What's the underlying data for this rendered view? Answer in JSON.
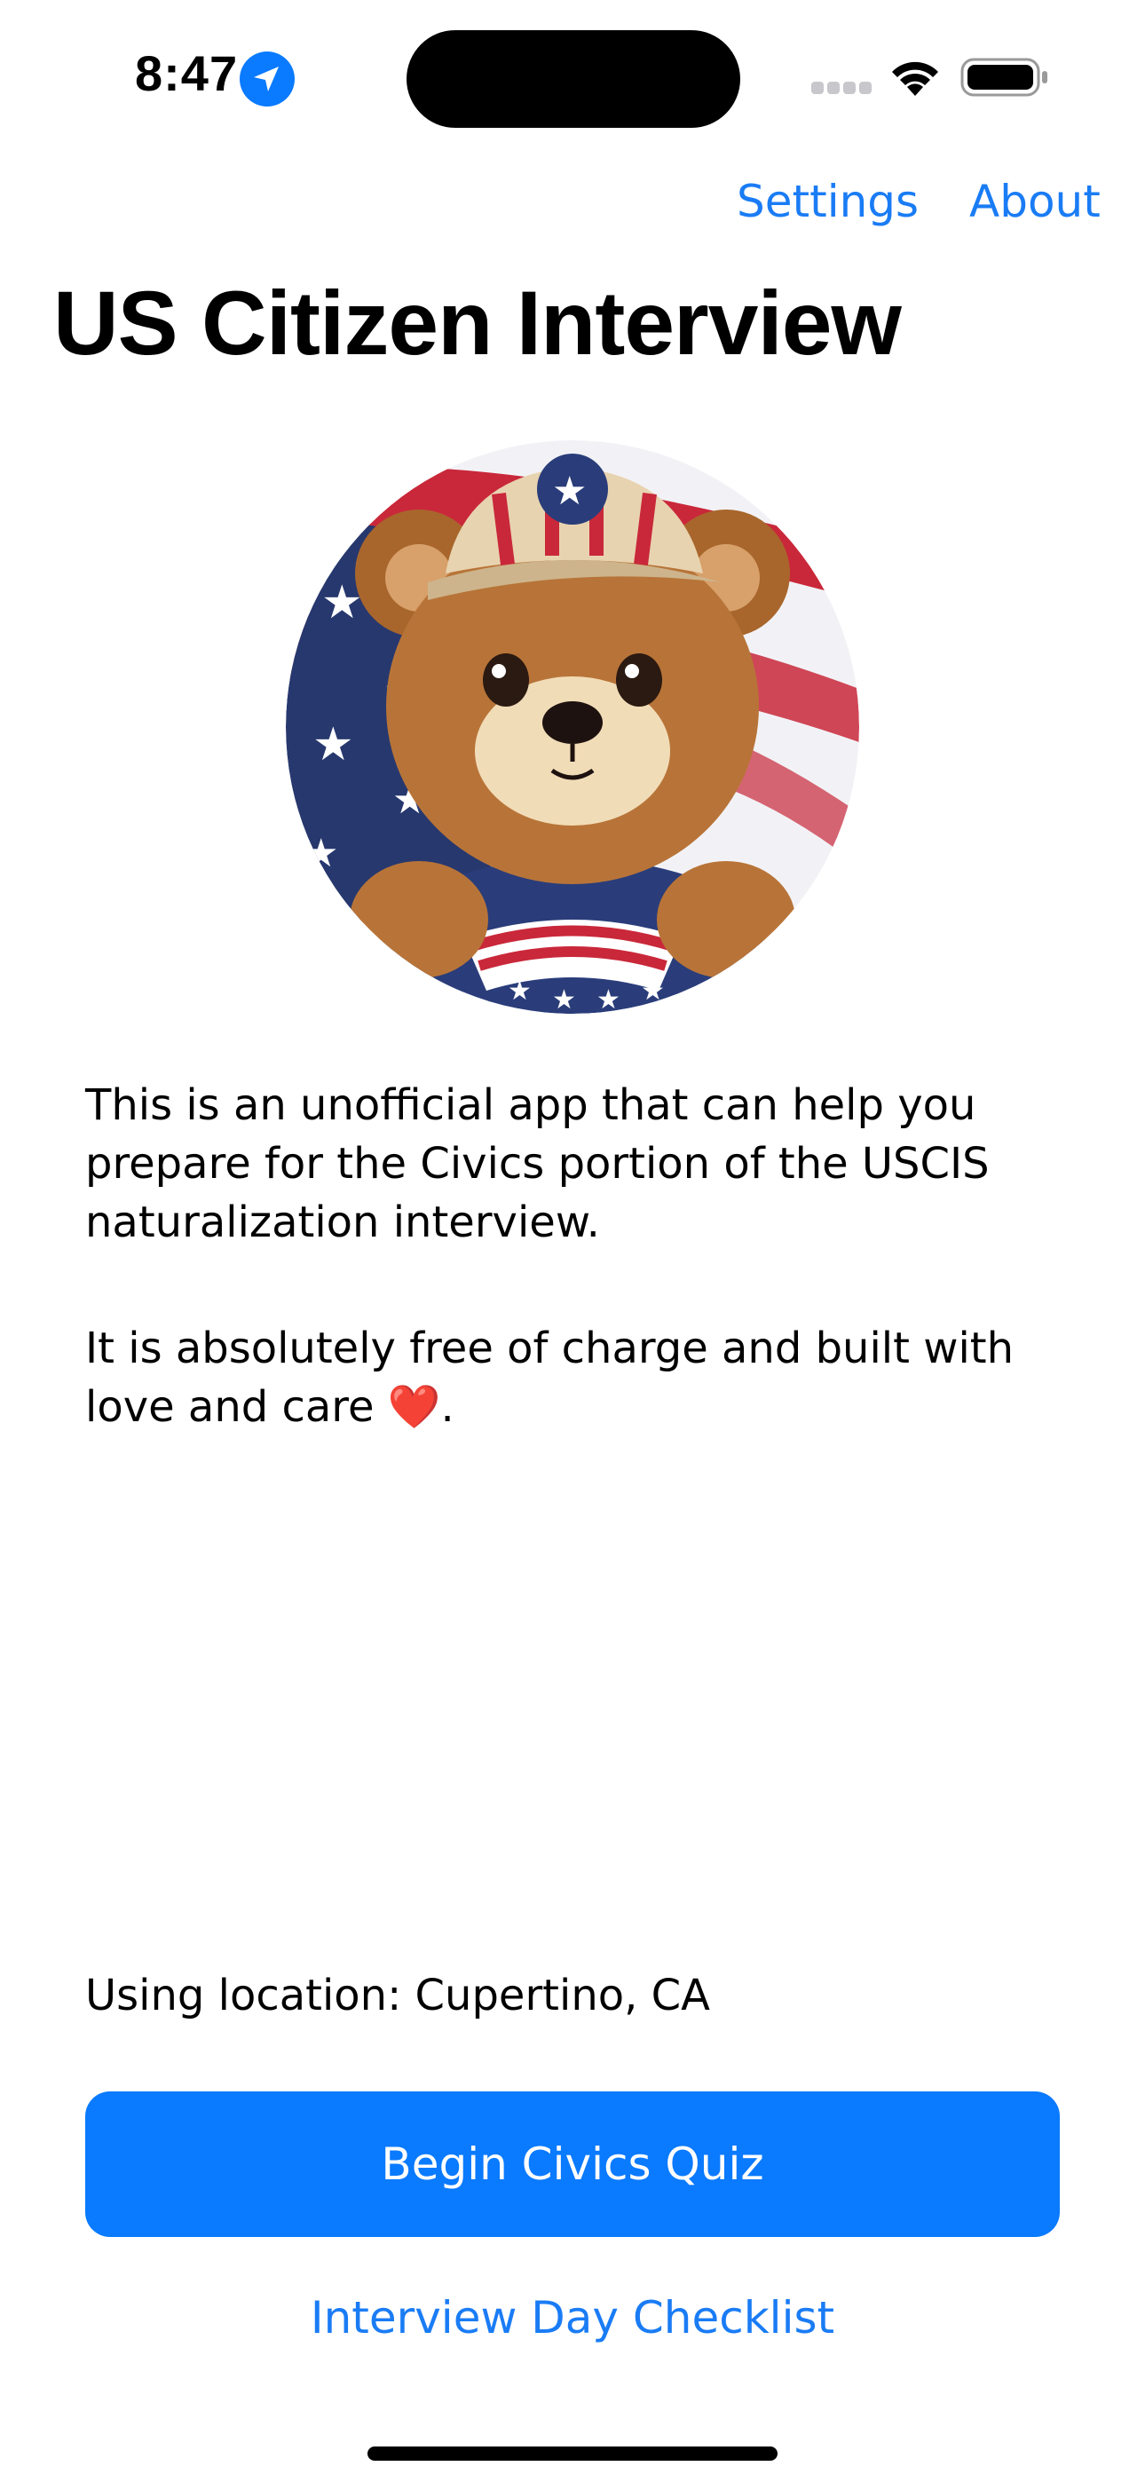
{
  "status_bar": {
    "time": "8:47",
    "location_icon": "location-arrow-icon",
    "wifi_icon": "wifi-icon",
    "battery_icon": "battery-full-icon"
  },
  "nav": {
    "settings_label": "Settings",
    "about_label": "About"
  },
  "page": {
    "title": "US Citizen Interview",
    "mascot_icon": "teddy-bear-flag-mascot",
    "intro_paragraph_1": "This is an unofficial app that can help you prepare for the Civics portion of the USCIS naturalization interview.",
    "intro_paragraph_2_text": "It is absolutely free of charge and built with love and care ",
    "intro_paragraph_2_emoji": "❤️",
    "intro_paragraph_2_end": ".",
    "location_text": "Using location: Cupertino, CA"
  },
  "actions": {
    "primary_button_label": "Begin Civics Quiz",
    "secondary_link_label": "Interview Day Checklist"
  },
  "colors": {
    "accent": "#0a7aff",
    "link": "#1a7cf5"
  }
}
